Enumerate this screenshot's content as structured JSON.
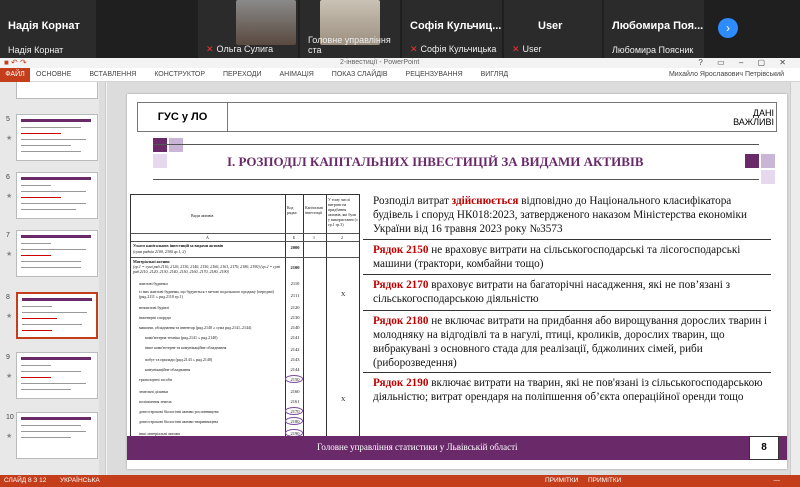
{
  "participants": [
    {
      "name": "Надія Корнат",
      "label": "Надія Корнат",
      "muted": false
    },
    {
      "name": "",
      "label": "Ольга Сулига",
      "muted": true
    },
    {
      "name": "",
      "label": "Головне управління ста",
      "muted": true
    },
    {
      "name": "Софія Кульчиц...",
      "label": "Софія Кульчицька",
      "muted": true
    },
    {
      "name": "User",
      "label": "User",
      "muted": true
    },
    {
      "name": "Любомира Поя...",
      "label": "Любомира Поясник",
      "muted": false
    }
  ],
  "ppt": {
    "doc_title": "2-інвестиції - PowerPoint",
    "file_tab": "ФАЙЛ",
    "tabs": [
      "ОСНОВНЕ",
      "ВСТАВЛЕННЯ",
      "КОНСТРУКТОР",
      "ПЕРЕХОДИ",
      "АНІМАЦІЯ",
      "ПОКАЗ СЛАЙДІВ",
      "РЕЦЕНЗУВАННЯ",
      "ВИГЛЯД"
    ],
    "user": "Михайло Ярославович Петрівський",
    "thumbnails": [
      "5",
      "6",
      "7",
      "8",
      "9",
      "10"
    ],
    "status": {
      "slide": "СЛАЙД 8 З 12",
      "language": "УКРАЇНСЬКА",
      "notes": "ПРИМІТКИ",
      "comments": "ПРИМІТКИ",
      "zoom": "—"
    }
  },
  "slide": {
    "header_left": "ГУС у ЛО",
    "header_right_1": "ДАНІ",
    "header_right_2": "ВАЖЛИВІ",
    "title": "І. РОЗПОДІЛ КАПІТАЛЬНИХ ІНВЕСТИЦІЙ ЗА ВИДАМИ АКТИВІВ",
    "para1_a": "Розподіл витрат ",
    "para1_red": "здійснюється",
    "para1_b": " відповідно до Національного класифікатора будівель і споруд НК018:2023, затвердженого наказом Міністерства економіки України від 16 травня 2023 року №3573",
    "para2_red": "Рядок 2150",
    "para2": " не враховує витрати на сільськогосподарські та лісогосподарські машини (трактори, комбайни тощо)",
    "para3_red": "Рядок 2170",
    "para3": " враховує витрати на багаторічні насадження, які не пов’язані з сільськогосподарською діяльністю",
    "para4_red": "Рядок 2180",
    "para4": " не включає витрати на придбання або вирощування дорослих тварин і молодняку на відгодівлі та в нагулі, птиці, кроликів, дорослих тварин, що вибракувані з основного стада для реалізації, бджолиних сімей, риби (риборозведення)",
    "para5_red": "Рядок 2190",
    "para5": " включає витрати на тварин, які не пов'язані із сільськогосподарською діяльністю; витрат орендаря на поліпшення об’єкта операційної оренди тощо",
    "footer": "Головне управління статистики у Львівській області",
    "page": "8"
  },
  "table": {
    "col_head_1": "Види активів",
    "col_head_2": "Код рядка",
    "col_head_3": "Капітальні інвестиції",
    "col_head_4": "У тому числі витрати на придбання активів, які були у використанні (з гр.1 гр.3)",
    "col_letters": [
      "А",
      "Б",
      "1",
      "2"
    ],
    "row_total": "Усього капітальних інвестицій за видами активів",
    "row_total_sub": "(сума рядків 2100, 2300 гр.1, 2)",
    "row_mat": "Матеріальні активи",
    "row_mat_sub": "(гр.1 = сумі ряд.2110, 2120, 2130, 2140, 2150, 2160, 2161, 2170, 2180, 2190) (гр.2 = сумі ряд.2110, 2120, 2130, 2140, 2150, 2160, 2170, 2180, 2190)",
    "rows": [
      {
        "label": "житлові будинки",
        "code": "2110"
      },
      {
        "label": "із них житлові будинки, що будуються з метою подальшого продажу (передачі) (ряд.2111 ≤ ряд.2110 гр.1)",
        "code": "2111",
        "x": "Х"
      },
      {
        "label": "нежитлові будівлі",
        "code": "2120"
      },
      {
        "label": "інженерні споруди",
        "code": "2130"
      },
      {
        "label": "машини, обладнання та інвентар (ряд.2140 ≥ сума ряд.2141–2144)",
        "code": "2140"
      },
      {
        "label": "комп'ютерна техніка (ряд.2141 ≤ ряд.2140)",
        "code": "2141"
      },
      {
        "label": "інше комп'ютерне та комунікаційне обладнання",
        "code": "2142"
      },
      {
        "label": "побут та прилади (ряд.2143 ≤ ряд.2140)",
        "code": "2143"
      },
      {
        "label": "комунікаційне обладнання",
        "code": "2144"
      },
      {
        "label": "транспортні засоби",
        "code": "2150"
      },
      {
        "label": "земельні ділянки",
        "code": "2160"
      },
      {
        "label": "поліпшення земель",
        "code": "2161",
        "x": "Х"
      },
      {
        "label": "довгострокові біологічні активи рослинництва",
        "code": "2170"
      },
      {
        "label": "довгострокові біологічні активи тваринництва",
        "code": "2180"
      },
      {
        "label": "інші матеріальні активи",
        "code": "2190"
      }
    ],
    "code_total": "2000",
    "code_mat": "2100"
  },
  "colors": {
    "accent": "#6a2a6a",
    "red": "#c00000",
    "ppt": "#c43e1c"
  }
}
